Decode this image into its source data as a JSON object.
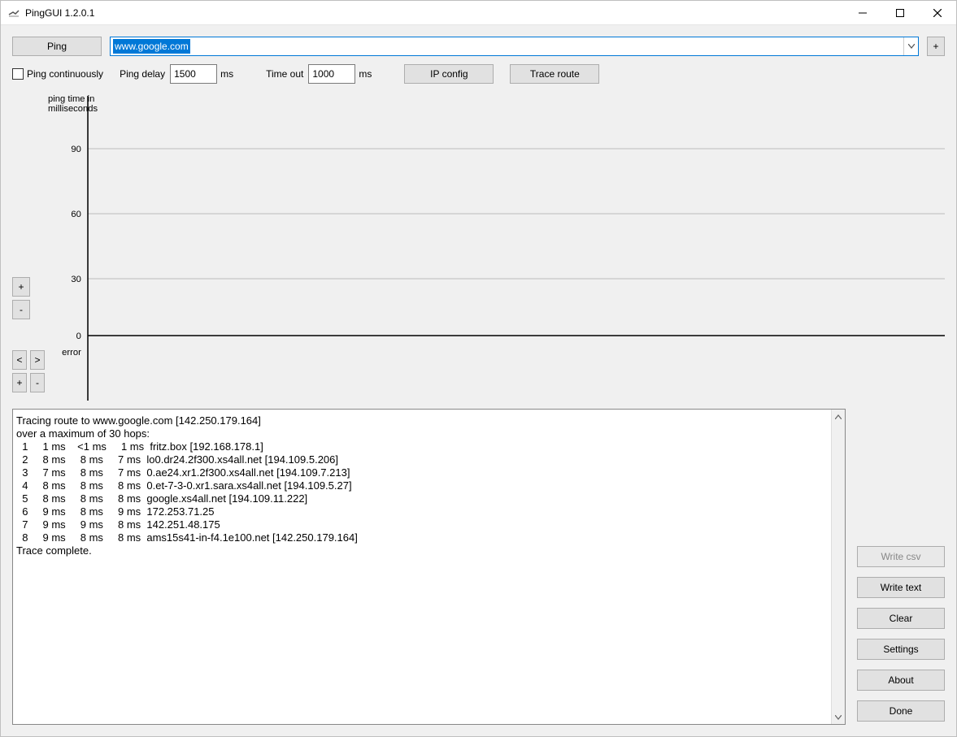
{
  "window": {
    "title": "PingGUI 1.2.0.1"
  },
  "toolbar": {
    "ping_label": "Ping",
    "host_value": "www.google.com",
    "add_label": "+"
  },
  "options": {
    "continuous_label": "Ping continuously",
    "continuous_checked": false,
    "delay_label": "Ping delay",
    "delay_value": "1500",
    "delay_unit": "ms",
    "timeout_label": "Time out",
    "timeout_value": "1000",
    "timeout_unit": "ms",
    "ipconfig_label": "IP config",
    "traceroute_label": "Trace route"
  },
  "chart": {
    "y_axis_title_line1": "ping time in",
    "y_axis_title_line2": "milliseconds",
    "ticks": [
      "90",
      "60",
      "30",
      "0"
    ],
    "error_label": "error",
    "zoom_in": "+",
    "zoom_out": "-",
    "pan_left": "<",
    "pan_right": ">",
    "hzoom_in": "+",
    "hzoom_out": "-"
  },
  "output": {
    "header_line1": "Tracing route to www.google.com [142.250.179.164]",
    "header_line2": "over a maximum of 30 hops:",
    "footer": "Trace complete.",
    "hops": [
      {
        "n": "1",
        "t1": "1 ms",
        "t2": "<1 ms",
        "t3": "1 ms",
        "host": "fritz.box [192.168.178.1]"
      },
      {
        "n": "2",
        "t1": "8 ms",
        "t2": "8 ms",
        "t3": "7 ms",
        "host": "lo0.dr24.2f300.xs4all.net [194.109.5.206]"
      },
      {
        "n": "3",
        "t1": "7 ms",
        "t2": "8 ms",
        "t3": "7 ms",
        "host": "0.ae24.xr1.2f300.xs4all.net [194.109.7.213]"
      },
      {
        "n": "4",
        "t1": "8 ms",
        "t2": "8 ms",
        "t3": "8 ms",
        "host": "0.et-7-3-0.xr1.sara.xs4all.net [194.109.5.27]"
      },
      {
        "n": "5",
        "t1": "8 ms",
        "t2": "8 ms",
        "t3": "8 ms",
        "host": "google.xs4all.net [194.109.11.222]"
      },
      {
        "n": "6",
        "t1": "9 ms",
        "t2": "8 ms",
        "t3": "9 ms",
        "host": "172.253.71.25"
      },
      {
        "n": "7",
        "t1": "9 ms",
        "t2": "9 ms",
        "t3": "8 ms",
        "host": "142.251.48.175"
      },
      {
        "n": "8",
        "t1": "9 ms",
        "t2": "8 ms",
        "t3": "8 ms",
        "host": "ams15s41-in-f4.1e100.net [142.250.179.164]"
      }
    ]
  },
  "side": {
    "write_csv": "Write csv",
    "write_text": "Write text",
    "clear": "Clear",
    "settings": "Settings",
    "about": "About",
    "done": "Done"
  },
  "chart_data": {
    "type": "line",
    "title": "ping time in milliseconds",
    "ylabel": "ping time (ms)",
    "ylim": [
      0,
      90
    ],
    "yticks": [
      0,
      30,
      60,
      90
    ],
    "x": [],
    "series": [
      {
        "name": "ping",
        "values": []
      }
    ],
    "error_band_label": "error"
  }
}
